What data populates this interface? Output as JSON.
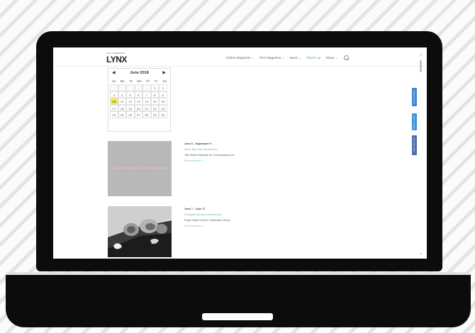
{
  "site": {
    "logo_small": "LOS ANGELES",
    "logo": "LYNX"
  },
  "nav": {
    "items": [
      {
        "label": "Online Magazine ⌄",
        "active": false
      },
      {
        "label": "Print Magazine ⌄",
        "active": false
      },
      {
        "label": "News ⌄",
        "active": false
      },
      {
        "label": "What's up",
        "active": true
      },
      {
        "label": "About ⌄",
        "active": false
      }
    ],
    "search_icon": "search-icon"
  },
  "calendar": {
    "prev": "◀",
    "next": "▶",
    "title": "June 2018",
    "dow": [
      "Su",
      "Mo",
      "Tu",
      "We",
      "Th",
      "Fr",
      "Sa"
    ],
    "days": [
      "",
      "",
      "",
      "",
      "",
      "1",
      "2",
      "3",
      "4",
      "5",
      "6",
      "7",
      "8",
      "9",
      "10",
      "11",
      "12",
      "13",
      "14",
      "15",
      "16",
      "17",
      "18",
      "19",
      "20",
      "21",
      "22",
      "23",
      "24",
      "25",
      "26",
      "27",
      "28",
      "29",
      "30"
    ],
    "today": "10"
  },
  "events": [
    {
      "image_text": "WE DON'T NEED ANOTHER HERO",
      "date": "June 6 - September 9",
      "venue": "Berlin Biennale Kunstwerke",
      "title": "10th Berlin Biennale for Contemporary Art",
      "more": "Find out more »"
    },
    {
      "date": "June 7 - June 17",
      "venue": "Fotografie Museum Amsterdam",
      "title": "Foam Talent Call for Graduation Show",
      "more": "Find out more »"
    }
  ],
  "social": [
    {
      "label": "Like on Facebook",
      "icon": "facebook-icon"
    },
    {
      "label": "Follow on Twitter",
      "icon": "twitter-icon"
    },
    {
      "label": "Share on Facebook",
      "icon": "share-icon"
    }
  ],
  "scroll": {
    "up": "▲",
    "down": "▼"
  },
  "colors": {
    "accent": "#4fb38a",
    "today_highlight": "#f2ee3a",
    "laptop": "#0c0c0c"
  }
}
